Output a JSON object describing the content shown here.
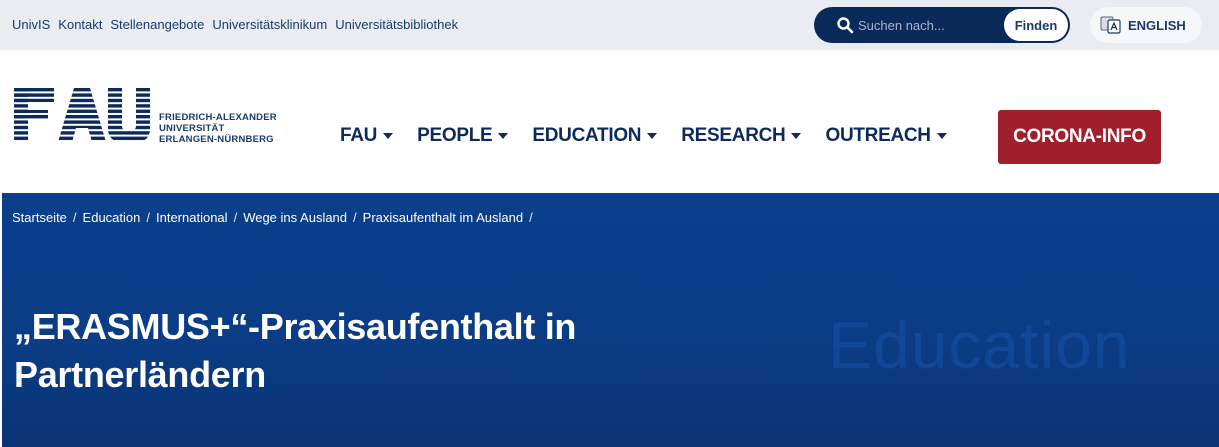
{
  "topbar": {
    "links": [
      "UnivIS",
      "Kontakt",
      "Stellenangebote",
      "Universitätsklinikum",
      "Universitätsbibliothek"
    ],
    "search": {
      "placeholder": "Suchen nach...",
      "button_label": "Finden",
      "icon": "search-icon"
    },
    "language": {
      "label": "ENGLISH",
      "icon": "language-icon"
    }
  },
  "header": {
    "logo": {
      "wordmark": "FAU",
      "lines": [
        "FRIEDRICH-ALEXANDER",
        "UNIVERSITÄT",
        "ERLANGEN-NÜRNBERG"
      ]
    },
    "nav": [
      {
        "label": "FAU"
      },
      {
        "label": "PEOPLE"
      },
      {
        "label": "EDUCATION"
      },
      {
        "label": "RESEARCH"
      },
      {
        "label": "OUTREACH"
      }
    ],
    "corona_button": "CORONA-INFO"
  },
  "hero": {
    "breadcrumb": [
      "Startseite",
      "Education",
      "International",
      "Wege ins Ausland",
      "Praxisaufenthalt im Ausland"
    ],
    "title_line1": "„ERASMUS+“-Praxisaufenthalt in",
    "title_line2": "Partnerländern",
    "watermark": "Education"
  },
  "colors": {
    "navy": "#0d2a5c",
    "hero_blue": "#0b3f8a",
    "corona_red": "#a01f2d",
    "topbar_bg": "#e9ecf1"
  }
}
